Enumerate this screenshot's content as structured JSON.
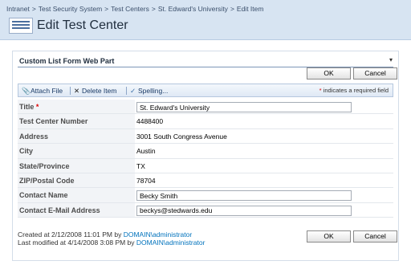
{
  "breadcrumb": [
    "Intranet",
    "Test Security System",
    "Test Centers",
    "St. Edward's University",
    "Edit Item"
  ],
  "breadcrumb_separator": ">",
  "page": {
    "title": "Edit Test Center"
  },
  "webpart": {
    "title": "Custom List Form Web Part",
    "menu_glyph": "▾"
  },
  "buttons": {
    "ok": "OK",
    "cancel": "Cancel"
  },
  "toolbar": {
    "attach": "Attach File",
    "delete": "Delete Item",
    "spelling": "Spelling...",
    "required_star": "*",
    "required_note": "indicates a required field"
  },
  "fields": {
    "title": {
      "label": "Title",
      "required": "*",
      "value": "St. Edward's University"
    },
    "test_center_number": {
      "label": "Test Center Number",
      "value": "4488400"
    },
    "address": {
      "label": "Address",
      "value": "3001 South Congress Avenue"
    },
    "city": {
      "label": "City",
      "value": "Austin"
    },
    "state": {
      "label": "State/Province",
      "value": "TX"
    },
    "zip": {
      "label": "ZIP/Postal Code",
      "value": "78704"
    },
    "contact_name": {
      "label": "Contact Name",
      "value": "Becky Smith"
    },
    "contact_email": {
      "label": "Contact E-Mail Address",
      "value": "beckys@stedwards.edu"
    }
  },
  "footer": {
    "created_prefix": "Created at 2/12/2008 11:01 PM  by",
    "created_by": "DOMAIN\\administrator",
    "modified_prefix": "Last modified at 4/14/2008 3:08 PM  by",
    "modified_by": "DOMAIN\\administrator"
  }
}
